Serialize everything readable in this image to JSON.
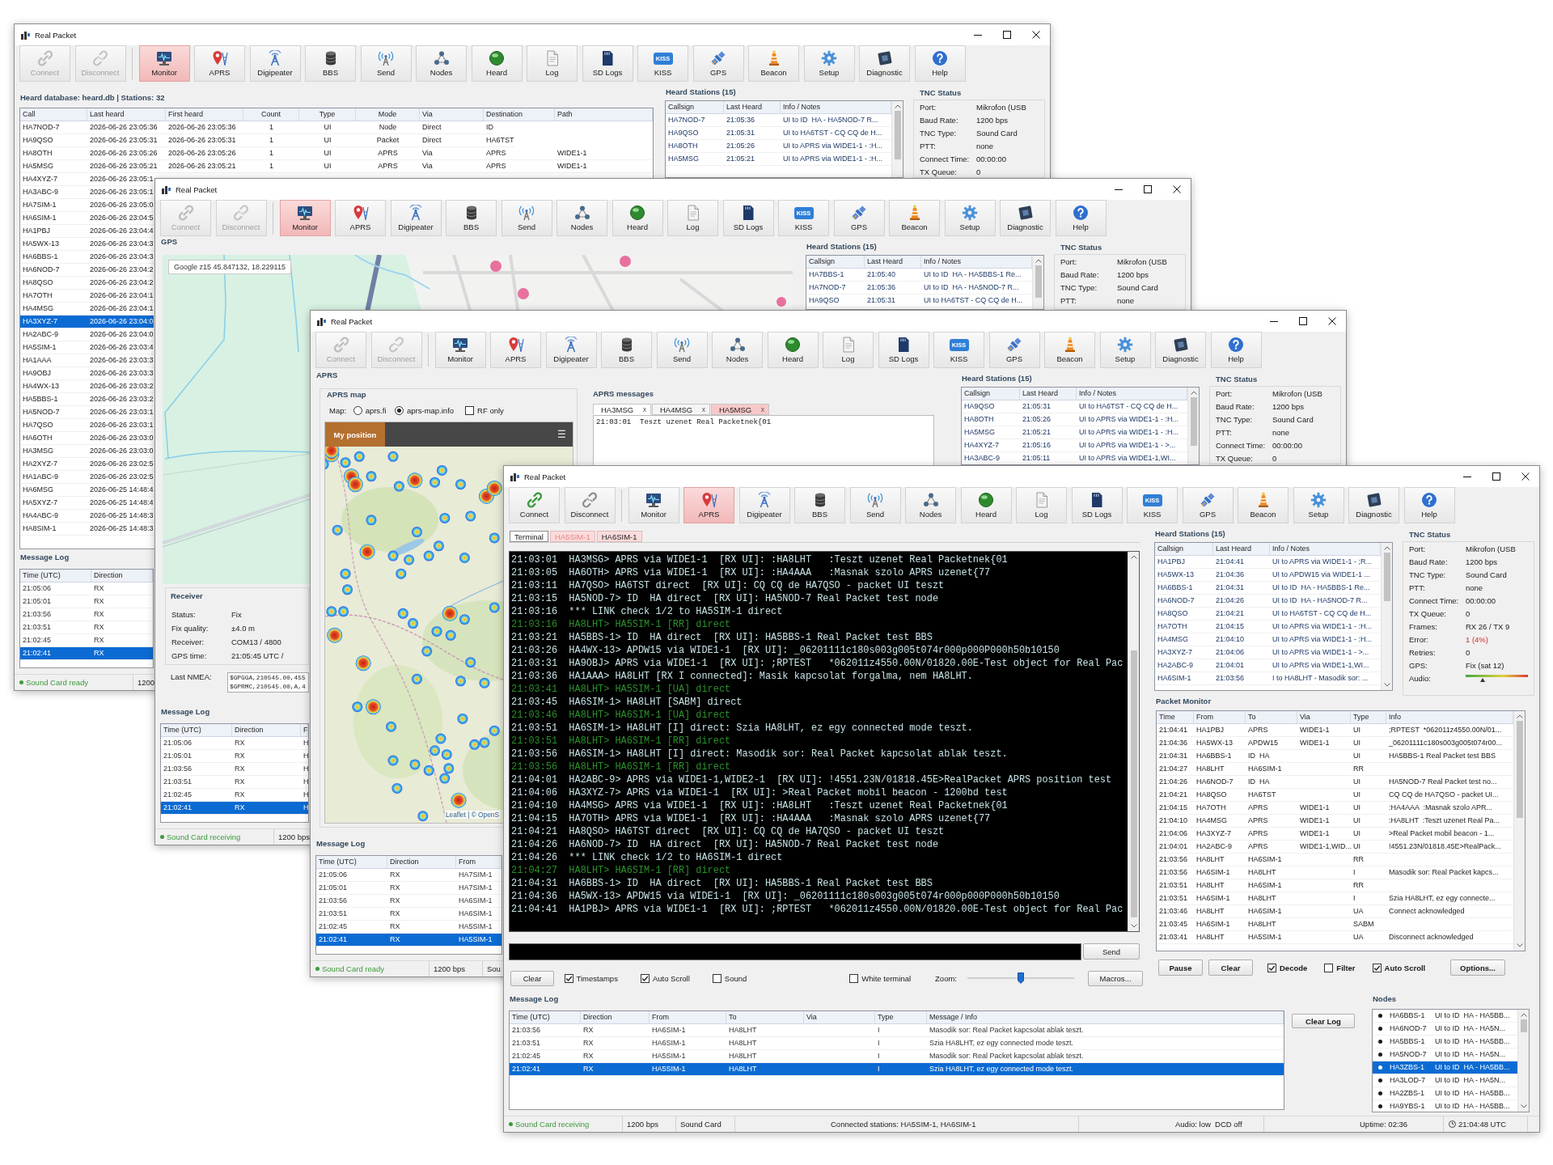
{
  "windows": [
    {
      "kind": "heard_db",
      "title": "Real Packet",
      "toolbar": [
        {
          "label": "Connect",
          "selected": false,
          "disabled": true
        },
        {
          "label": "Disconnect",
          "selected": false,
          "disabled": true
        },
        {
          "label": "Monitor",
          "selected": true,
          "disabled": false
        },
        {
          "label": "APRS",
          "selected": false,
          "disabled": false
        },
        {
          "label": "Digipeater",
          "selected": false,
          "disabled": false
        },
        {
          "label": "BBS",
          "selected": false,
          "disabled": false
        },
        {
          "label": "Send",
          "selected": false,
          "disabled": false
        },
        {
          "label": "Nodes",
          "selected": false,
          "disabled": false
        },
        {
          "label": "Heard",
          "selected": false,
          "disabled": false
        },
        {
          "label": "Log",
          "selected": false,
          "disabled": false
        },
        {
          "label": "SD Logs",
          "selected": false,
          "disabled": false
        },
        {
          "label": "KISS",
          "badge": "KISS",
          "selected": false,
          "disabled": false
        },
        {
          "label": "GPS",
          "selected": false,
          "disabled": false
        },
        {
          "label": "Beacon",
          "selected": false,
          "disabled": false
        },
        {
          "label": "Setup",
          "selected": false,
          "disabled": false
        },
        {
          "label": "Diagnostic",
          "selected": false,
          "disabled": false
        },
        {
          "label": "Help",
          "selected": false,
          "disabled": false
        }
      ],
      "heard_db": {
        "title": "Heard database: heard.db | Stations: 32",
        "columns": [
          "Call",
          "Last heard",
          "First heard",
          "Count",
          "Type",
          "Mode",
          "Via",
          "Destination",
          "Path"
        ],
        "rows": [
          {
            "call": "HA7NOD-7",
            "last_heard": "2026-06-26 23:05:36",
            "first_heard": "2026-06-26 23:05:36",
            "count": "1",
            "type": "UI",
            "mode": "Node",
            "via": "Direct",
            "destination": "ID",
            "selected": false
          },
          {
            "call": "HA9QSO",
            "last_heard": "2026-06-26 23:05:31",
            "first_heard": "2026-06-26 23:05:31",
            "count": "1",
            "type": "UI",
            "mode": "Packet",
            "via": "Direct",
            "destination": "HA6TST",
            "selected": false
          },
          {
            "call": "HA8OTH",
            "last_heard": "2026-06-26 23:05:26",
            "first_heard": "2026-06-26 23:05:26",
            "count": "1",
            "type": "UI",
            "mode": "APRS",
            "via": "Via",
            "destination": "APRS",
            "path": "WIDE1-1",
            "selected": false
          },
          {
            "call": "HA5MSG",
            "last_heard": "2026-06-26 23:05:21",
            "first_heard": "2026-06-26 23:05:21",
            "count": "1",
            "type": "UI",
            "mode": "APRS",
            "via": "Via",
            "destination": "APRS",
            "path": "WIDE1-1",
            "selected": false
          },
          {
            "call": "HA4XYZ-7",
            "last_heard": "2026-06-26 23:05:1",
            "selected": false
          },
          {
            "call": "HA3ABC-9",
            "last_heard": "2026-06-26 23:05:1",
            "selected": false
          },
          {
            "call": "HA7SIM-1",
            "last_heard": "2026-06-26 23:05:0",
            "selected": false
          },
          {
            "call": "HA6SIM-1",
            "last_heard": "2026-06-26 23:04:5",
            "selected": false
          },
          {
            "call": "HA1PBJ",
            "last_heard": "2026-06-26 23:04:4",
            "selected": false
          },
          {
            "call": "HA5WX-13",
            "last_heard": "2026-06-26 23:04:3",
            "selected": false
          },
          {
            "call": "HA6BBS-1",
            "last_heard": "2026-06-26 23:04:3",
            "selected": false
          },
          {
            "call": "HA6NOD-7",
            "last_heard": "2026-06-26 23:04:2",
            "selected": false
          },
          {
            "call": "HA8QSO",
            "last_heard": "2026-06-26 23:04:2",
            "selected": false
          },
          {
            "call": "HA7OTH",
            "last_heard": "2026-06-26 23:04:1",
            "selected": false
          },
          {
            "call": "HA4MSG",
            "last_heard": "2026-06-26 23:04:1",
            "selected": false
          },
          {
            "call": "HA3XYZ-7",
            "last_heard": "2026-06-26 23:04:0",
            "selected": true
          },
          {
            "call": "HA2ABC-9",
            "last_heard": "2026-06-26 23:04:0",
            "selected": false
          },
          {
            "call": "HA5SIM-1",
            "last_heard": "2026-06-26 23:03:4",
            "selected": false
          },
          {
            "call": "HA1AAA",
            "last_heard": "2026-06-26 23:03:3",
            "selected": false
          },
          {
            "call": "HA9OBJ",
            "last_heard": "2026-06-26 23:03:3",
            "selected": false
          },
          {
            "call": "HA4WX-13",
            "last_heard": "2026-06-26 23:03:2",
            "selected": false
          },
          {
            "call": "HA5BBS-1",
            "last_heard": "2026-06-26 23:03:2",
            "selected": false
          },
          {
            "call": "HA5NOD-7",
            "last_heard": "2026-06-26 23:03:1",
            "selected": false
          },
          {
            "call": "HA7QSO",
            "last_heard": "2026-06-26 23:03:1",
            "selected": false
          },
          {
            "call": "HA6OTH",
            "last_heard": "2026-06-26 23:03:0",
            "selected": false
          },
          {
            "call": "HA3MSG",
            "last_heard": "2026-06-26 23:03:0",
            "selected": false
          },
          {
            "call": "HA2XYZ-7",
            "last_heard": "2026-06-26 23:02:5",
            "selected": false
          },
          {
            "call": "HA1ABC-9",
            "last_heard": "2026-06-26 23:02:5",
            "selected": false
          },
          {
            "call": "HA6MSG",
            "last_heard": "2026-06-25 14:48:4",
            "selected": false
          },
          {
            "call": "HA5XYZ-7",
            "last_heard": "2026-06-25 14:48:4",
            "selected": false
          },
          {
            "call": "HA4ABC-9",
            "last_heard": "2026-06-25 14:48:3",
            "selected": false
          },
          {
            "call": "HA8SIM-1",
            "last_heard": "2026-06-25 14:48:3",
            "selected": false
          }
        ]
      },
      "heard_stations": {
        "title": "Heard Stations (15)",
        "columns": [
          "Callsign",
          "Last Heard",
          "Info / Notes"
        ],
        "rows": [
          {
            "callsign": "HA7NOD-7",
            "last_heard": "21:05:36",
            "info": "UI to ID  HA - HA5NOD-7 R...",
            "selected": false
          },
          {
            "callsign": "HA9QSO",
            "last_heard": "21:05:31",
            "info": "UI to HA6TST - CQ CQ de H...",
            "selected": false
          },
          {
            "callsign": "HA8OTH",
            "last_heard": "21:05:26",
            "info": "UI to APRS via WIDE1-1 - :H...",
            "selected": false
          },
          {
            "callsign": "HA5MSG",
            "last_heard": "21:05:21",
            "info": "UI to APRS via WIDE1-1 - :H...",
            "selected": false
          }
        ]
      },
      "tnc_status": {
        "title": "TNC Status",
        "rows": [
          {
            "kind": "text",
            "label": "Port:",
            "value": "Mikrofon (USB"
          },
          {
            "kind": "text",
            "label": "Baud Rate:",
            "value": "1200 bps"
          },
          {
            "kind": "text",
            "label": "TNC Type:",
            "value": "Sound Card"
          },
          {
            "kind": "text",
            "label": "PTT:",
            "value": "none"
          },
          {
            "kind": "text",
            "label": "Connect Time:",
            "value": "00:00:00"
          },
          {
            "kind": "text",
            "label": "TX Queue:",
            "value": "0"
          }
        ]
      },
      "message_log": {
        "title": "Message Log",
        "columns": [
          "Time (UTC)",
          "Direction"
        ],
        "rows": [
          {
            "time": "21:05:06",
            "direction": "RX",
            "selected": false
          },
          {
            "time": "21:05:01",
            "direction": "RX",
            "selected": false
          },
          {
            "time": "21:03:56",
            "direction": "RX",
            "selected": false
          },
          {
            "time": "21:03:51",
            "direction": "RX",
            "selected": false
          },
          {
            "time": "21:02:45",
            "direction": "RX",
            "selected": false
          },
          {
            "time": "21:02:41",
            "direction": "RX",
            "selected": true
          }
        ]
      },
      "status_bar": [
        "Sound Card ready",
        "1200"
      ]
    },
    {
      "kind": "gps",
      "title": "Real Packet",
      "toolbar": [
        {
          "label": "Connect",
          "selected": false,
          "disabled": true
        },
        {
          "label": "Disconnect",
          "selected": false,
          "disabled": true
        },
        {
          "label": "Monitor",
          "selected": true,
          "disabled": false
        },
        {
          "label": "APRS",
          "selected": false,
          "disabled": false
        },
        {
          "label": "Digipeater",
          "selected": false,
          "disabled": false
        },
        {
          "label": "BBS",
          "selected": false,
          "disabled": false
        },
        {
          "label": "Send",
          "selected": false,
          "disabled": false
        },
        {
          "label": "Nodes",
          "selected": false,
          "disabled": false
        },
        {
          "label": "Heard",
          "selected": false,
          "disabled": false
        },
        {
          "label": "Log",
          "selected": false,
          "disabled": false
        },
        {
          "label": "SD Logs",
          "selected": false,
          "disabled": false
        },
        {
          "label": "KISS",
          "badge": "KISS",
          "selected": false,
          "disabled": false
        },
        {
          "label": "GPS",
          "selected": false,
          "disabled": false
        },
        {
          "label": "Beacon",
          "selected": false,
          "disabled": false
        },
        {
          "label": "Setup",
          "selected": false,
          "disabled": false
        },
        {
          "label": "Diagnostic",
          "selected": false,
          "disabled": false
        },
        {
          "label": "Help",
          "selected": false,
          "disabled": false
        }
      ],
      "gps": {
        "title": "GPS",
        "map_label": "Google z15 45.847132, 18.229115",
        "receiver": {
          "title": "Receiver",
          "rows": [
            {
              "label": "Status:",
              "value": "Fix"
            },
            {
              "label": "Fix quality:",
              "value": "±4.0 m"
            },
            {
              "label": "Receiver:",
              "value": "COM13 / 4800"
            },
            {
              "label": "GPS time:",
              "value": "21:05:45 UTC /"
            }
          ]
        },
        "nmea": {
          "label": "Last NMEA:",
          "lines": [
            "$GPGGA,210545.00,455",
            "$GPRMC,210545.00,A,4"
          ]
        }
      },
      "heard_stations": {
        "title": "Heard Stations (15)",
        "columns": [
          "Callsign",
          "Last Heard",
          "Info / Notes"
        ],
        "rows": [
          {
            "callsign": "HA7BBS-1",
            "last_heard": "21:05:40",
            "info": "UI to ID  HA - HA5BBS-1 Re...",
            "selected": false
          },
          {
            "callsign": "HA7NOD-7",
            "last_heard": "21:05:36",
            "info": "UI to ID  HA - HA5NOD-7 R...",
            "selected": false
          },
          {
            "callsign": "HA9QSO",
            "last_heard": "21:05:31",
            "info": "UI to HA6TST - CQ CQ de H...",
            "selected": false
          }
        ]
      },
      "tnc_status": {
        "title": "TNC Status",
        "rows": [
          {
            "kind": "text",
            "label": "Port:",
            "value": "Mikrofon (USB"
          },
          {
            "kind": "text",
            "label": "Baud Rate:",
            "value": "1200 bps"
          },
          {
            "kind": "text",
            "label": "TNC Type:",
            "value": "Sound Card"
          },
          {
            "kind": "text",
            "label": "PTT:",
            "value": "none"
          }
        ]
      },
      "message_log": {
        "title": "Message Log",
        "columns": [
          "Time (UTC)",
          "Direction",
          "F"
        ],
        "rows": [
          {
            "time": "21:05:06",
            "direction": "RX",
            "from": "H",
            "selected": false
          },
          {
            "time": "21:05:01",
            "direction": "RX",
            "from": "H",
            "selected": false
          },
          {
            "time": "21:03:56",
            "direction": "RX",
            "from": "H",
            "selected": false
          },
          {
            "time": "21:03:51",
            "direction": "RX",
            "from": "H",
            "selected": false
          },
          {
            "time": "21:02:45",
            "direction": "RX",
            "from": "H",
            "selected": false
          },
          {
            "time": "21:02:41",
            "direction": "RX",
            "from": "H",
            "selected": true
          }
        ]
      },
      "status_bar": [
        "Sound Card receiving",
        "1200 bps"
      ]
    },
    {
      "kind": "aprs",
      "title": "Real Packet",
      "toolbar": [
        {
          "label": "Connect",
          "selected": false,
          "disabled": true
        },
        {
          "label": "Disconnect",
          "selected": false,
          "disabled": true
        },
        {
          "label": "Monitor",
          "selected": false,
          "disabled": false
        },
        {
          "label": "APRS",
          "selected": false,
          "disabled": false
        },
        {
          "label": "Digipeater",
          "selected": false,
          "disabled": false
        },
        {
          "label": "BBS",
          "selected": false,
          "disabled": false
        },
        {
          "label": "Send",
          "selected": false,
          "disabled": false
        },
        {
          "label": "Nodes",
          "selected": false,
          "disabled": false
        },
        {
          "label": "Heard",
          "selected": false,
          "disabled": false
        },
        {
          "label": "Log",
          "selected": false,
          "disabled": false
        },
        {
          "label": "SD Logs",
          "selected": false,
          "disabled": false
        },
        {
          "label": "KISS",
          "badge": "KISS",
          "selected": false,
          "disabled": false
        },
        {
          "label": "GPS",
          "selected": false,
          "disabled": false
        },
        {
          "label": "Beacon",
          "selected": false,
          "disabled": false
        },
        {
          "label": "Setup",
          "selected": false,
          "disabled": false
        },
        {
          "label": "Diagnostic",
          "selected": false,
          "disabled": false
        },
        {
          "label": "Help",
          "selected": false,
          "disabled": false
        }
      ],
      "aprs": {
        "title": "APRS",
        "map_group": {
          "title": "APRS map",
          "map_label": "Map:",
          "options": [
            {
              "label": "aprs.fi",
              "selected": false
            },
            {
              "label": "aprs-map.info",
              "selected": true
            }
          ],
          "rf_only": {
            "label": "RF only",
            "checked": false
          },
          "my_position": "My position",
          "menu": "☰",
          "attribution": "Leaflet | © OpenS"
        },
        "messages": {
          "title": "APRS messages",
          "tabs": [
            {
              "label": "HA3MSG",
              "close": "x",
              "selected": true,
              "unread": false
            },
            {
              "label": "HA4MSG",
              "close": "x",
              "selected": false,
              "unread": false
            },
            {
              "label": "HA5MSG",
              "close": "x",
              "selected": false,
              "unread": true
            }
          ],
          "lines": [
            "21:03:01  Teszt uzenet Real Packetnek{01"
          ]
        }
      },
      "heard_stations": {
        "title": "Heard Stations (15)",
        "columns": [
          "Callsign",
          "Last Heard",
          "Info / Notes"
        ],
        "rows": [
          {
            "callsign": "HA9QSO",
            "last_heard": "21:05:31",
            "info": "UI to HA6TST - CQ CQ de H...",
            "selected": false
          },
          {
            "callsign": "HA8OTH",
            "last_heard": "21:05:26",
            "info": "UI to APRS via WIDE1-1 - :H...",
            "selected": false
          },
          {
            "callsign": "HA5MSG",
            "last_heard": "21:05:21",
            "info": "UI to APRS via WIDE1-1 - :H...",
            "selected": false
          },
          {
            "callsign": "HA4XYZ-7",
            "last_heard": "21:05:16",
            "info": "UI to APRS via WIDE1-1 - >...",
            "selected": false
          },
          {
            "callsign": "HA3ABC-9",
            "last_heard": "21:05:11",
            "info": "UI to APRS via WIDE1-1,WI...",
            "selected": false
          }
        ]
      },
      "tnc_status": {
        "title": "TNC Status",
        "rows": [
          {
            "kind": "text",
            "label": "Port:",
            "value": "Mikrofon (USB"
          },
          {
            "kind": "text",
            "label": "Baud Rate:",
            "value": "1200 bps"
          },
          {
            "kind": "text",
            "label": "TNC Type:",
            "value": "Sound Card"
          },
          {
            "kind": "text",
            "label": "PTT:",
            "value": "none"
          },
          {
            "kind": "text",
            "label": "Connect Time:",
            "value": "00:00:00"
          },
          {
            "kind": "text",
            "label": "TX Queue:",
            "value": "0"
          }
        ]
      },
      "message_log": {
        "title": "Message Log",
        "columns": [
          "Time (UTC)",
          "Direction",
          "From"
        ],
        "rows": [
          {
            "time": "21:05:06",
            "direction": "RX",
            "from": "HA7SIM-1",
            "selected": false
          },
          {
            "time": "21:05:01",
            "direction": "RX",
            "from": "HA7SIM-1",
            "selected": false
          },
          {
            "time": "21:03:56",
            "direction": "RX",
            "from": "HA6SIM-1",
            "selected": false
          },
          {
            "time": "21:03:51",
            "direction": "RX",
            "from": "HA6SIM-1",
            "selected": false
          },
          {
            "time": "21:02:45",
            "direction": "RX",
            "from": "HA5SIM-1",
            "selected": false
          },
          {
            "time": "21:02:41",
            "direction": "RX",
            "from": "HA5SIM-1",
            "selected": true
          }
        ]
      },
      "status_bar": [
        "Sound Card ready",
        "1200 bps",
        "Sou"
      ]
    },
    {
      "kind": "terminal",
      "title": "Real Packet",
      "toolbar": [
        {
          "label": "Connect",
          "selected": false,
          "disabled": false
        },
        {
          "label": "Disconnect",
          "selected": false,
          "disabled": false
        },
        {
          "label": "Monitor",
          "selected": false,
          "disabled": false
        },
        {
          "label": "APRS",
          "selected": true,
          "disabled": false
        },
        {
          "label": "Digipeater",
          "selected": false,
          "disabled": false
        },
        {
          "label": "BBS",
          "selected": false,
          "disabled": false
        },
        {
          "label": "Send",
          "selected": false,
          "disabled": false
        },
        {
          "label": "Nodes",
          "selected": false,
          "disabled": false
        },
        {
          "label": "Heard",
          "selected": false,
          "disabled": false
        },
        {
          "label": "Log",
          "selected": false,
          "disabled": false
        },
        {
          "label": "SD Logs",
          "selected": false,
          "disabled": false
        },
        {
          "label": "KISS",
          "badge": "KISS",
          "selected": false,
          "disabled": false
        },
        {
          "label": "GPS",
          "selected": false,
          "disabled": false
        },
        {
          "label": "Beacon",
          "selected": false,
          "disabled": false
        },
        {
          "label": "Setup",
          "selected": false,
          "disabled": false
        },
        {
          "label": "Diagnostic",
          "selected": false,
          "disabled": false
        },
        {
          "label": "Help",
          "selected": false,
          "disabled": false
        }
      ],
      "terminal": {
        "tabs": [
          {
            "label": "Terminal",
            "selected": true
          },
          {
            "label": "HA5SIM-1",
            "selected": false,
            "connected": false
          },
          {
            "label": "HA6SIM-1",
            "selected": false,
            "connected": true
          }
        ],
        "lines": [
          {
            "kind": "rx",
            "text": "21:03:01  HA3MSG> APRS via WIDE1-1  [RX UI]: :HA8LHT   :Teszt uzenet Real Packetnek{01"
          },
          {
            "kind": "rx",
            "text": "21:03:05  HA6OTH> APRS via WIDE1-1  [RX UI]: :HA4AAA   :Masnak szolo APRS uzenet{77"
          },
          {
            "kind": "rx",
            "text": "21:03:11  HA7QSO> HA6TST direct  [RX UI]: CQ CQ de HA7QSO - packet UI teszt"
          },
          {
            "kind": "rx",
            "text": "21:03:15  HA5NOD-7> ID  HA direct  [RX UI]: HA5NOD-7 Real Packet test node"
          },
          {
            "kind": "rx",
            "text": "21:03:16  *** LINK check 1/2 to HA5SIM-1 direct"
          },
          {
            "kind": "tx",
            "text": "21:03:16  HA8LHT> HA5SIM-1 [RR] direct"
          },
          {
            "kind": "rx",
            "text": "21:03:21  HA5BBS-1> ID  HA direct  [RX UI]: HA5BBS-1 Real Packet test BBS"
          },
          {
            "kind": "rx",
            "text": "21:03:26  HA4WX-13> APDW15 via WIDE1-1  [RX UI]: _06201111c180s003g005t074r000p000P000h50b10150"
          },
          {
            "kind": "rx",
            "text": "21:03:31  HA9OBJ> APRS via WIDE1-1  [RX UI]: ;RPTEST   *062011z4550.00N/01820.00E-Test object for Real Pac"
          },
          {
            "kind": "rx",
            "text": "21:03:36  HA1AAA> HA8LHT [RX I connected]: Masik kapcsolat forgalma, nem HA8LHT."
          },
          {
            "kind": "tx",
            "text": "21:03:41  HA8LHT> HA5SIM-1 [UA] direct"
          },
          {
            "kind": "rx",
            "text": "21:03:45  HA6SIM-1> HA8LHT [SABM] direct"
          },
          {
            "kind": "tx",
            "text": "21:03:46  HA8LHT> HA6SIM-1 [UA] direct"
          },
          {
            "kind": "rx",
            "text": "21:03:51  HA6SIM-1> HA8LHT [I] direct: Szia HA8LHT, ez egy connected mode teszt."
          },
          {
            "kind": "tx",
            "text": "21:03:51  HA8LHT> HA6SIM-1 [RR] direct"
          },
          {
            "kind": "rx",
            "text": "21:03:56  HA6SIM-1> HA8LHT [I] direct: Masodik sor: Real Packet kapcsolat ablak teszt."
          },
          {
            "kind": "tx",
            "text": "21:03:56  HA8LHT> HA6SIM-1 [RR] direct"
          },
          {
            "kind": "rx",
            "text": "21:04:01  HA2ABC-9> APRS via WIDE1-1,WIDE2-1  [RX UI]: !4551.23N/01818.45E>RealPacket APRS position test"
          },
          {
            "kind": "rx",
            "text": "21:04:06  HA3XYZ-7> APRS via WIDE1-1  [RX UI]: >Real Packet mobil beacon - 1200bd test"
          },
          {
            "kind": "rx",
            "text": "21:04:10  HA4MSG> APRS via WIDE1-1  [RX UI]: :HA8LHT   :Teszt uzenet Real Packetnek{01"
          },
          {
            "kind": "rx",
            "text": "21:04:15  HA7OTH> APRS via WIDE1-1  [RX UI]: :HA4AAA   :Masnak szolo APRS uzenet{77"
          },
          {
            "kind": "rx",
            "text": "21:04:21  HA8QSO> HA6TST direct  [RX UI]: CQ CQ de HA7QSO - packet UI teszt"
          },
          {
            "kind": "rx",
            "text": "21:04:26  HA6NOD-7> ID  HA direct  [RX UI]: HA5NOD-7 Real Packet test node"
          },
          {
            "kind": "rx",
            "text": "21:04:26  *** LINK check 1/2 to HA6SIM-1 direct"
          },
          {
            "kind": "tx",
            "text": "21:04:27  HA8LHT> HA6SIM-1 [RR] direct"
          },
          {
            "kind": "rx",
            "text": "21:04:31  HA6BBS-1> ID  HA direct  [RX UI]: HA5BBS-1 Real Packet test BBS"
          },
          {
            "kind": "rx",
            "text": "21:04:36  HA5WX-13> APDW15 via WIDE1-1  [RX UI]: _06201111c180s003g005t074r000p000P000h50b10150"
          },
          {
            "kind": "rx",
            "text": "21:04:41  HA1PBJ> APRS via WIDE1-1  [RX UI]: ;RPTEST   *062011z4550.00N/01820.00E-Test object for Real Pac"
          }
        ],
        "send": "Send",
        "clear": "Clear",
        "checkboxes": [
          {
            "label": "Timestamps",
            "checked": true
          },
          {
            "label": "Auto Scroll",
            "checked": true
          },
          {
            "label": "Sound",
            "checked": false
          }
        ],
        "view_checkboxes": [
          {
            "label": "White terminal",
            "checked": false
          }
        ],
        "zoom_label": "Zoom:",
        "zoom": {
          "level": 0.5
        },
        "macros": "Macros..."
      },
      "heard_stations": {
        "title": "Heard Stations (15)",
        "columns": [
          "Callsign",
          "Last Heard",
          "Info / Notes"
        ],
        "rows": [
          {
            "callsign": "HA1PBJ",
            "last_heard": "21:04:41",
            "info": "UI to APRS via WIDE1-1 - ;R...",
            "selected": false
          },
          {
            "callsign": "HA5WX-13",
            "last_heard": "21:04:36",
            "info": "UI to APDW15 via WIDE1-1 ...",
            "selected": false
          },
          {
            "callsign": "HA6BBS-1",
            "last_heard": "21:04:31",
            "info": "UI to ID  HA - HA5BBS-1 Re...",
            "selected": false
          },
          {
            "callsign": "HA6NOD-7",
            "last_heard": "21:04:26",
            "info": "UI to ID  HA - HA5NOD-7 R...",
            "selected": false
          },
          {
            "callsign": "HA8QSO",
            "last_heard": "21:04:21",
            "info": "UI to HA6TST - CQ CQ de H...",
            "selected": false
          },
          {
            "callsign": "HA7OTH",
            "last_heard": "21:04:15",
            "info": "UI to APRS via WIDE1-1 - :H...",
            "selected": false
          },
          {
            "callsign": "HA4MSG",
            "last_heard": "21:04:10",
            "info": "UI to APRS via WIDE1-1 - :H...",
            "selected": false
          },
          {
            "callsign": "HA3XYZ-7",
            "last_heard": "21:04:06",
            "info": "UI to APRS via WIDE1-1 - >...",
            "selected": false
          },
          {
            "callsign": "HA2ABC-9",
            "last_heard": "21:04:01",
            "info": "UI to APRS via WIDE1-1,WI...",
            "selected": false
          },
          {
            "callsign": "HA6SIM-1",
            "last_heard": "21:03:56",
            "info": "I to HA8LHT - Masodik sor: ...",
            "selected": false
          }
        ]
      },
      "tnc_status": {
        "title": "TNC Status",
        "rows": [
          {
            "kind": "text",
            "label": "Port:",
            "value": "Mikrofon (USB"
          },
          {
            "kind": "text",
            "label": "Baud Rate:",
            "value": "1200 bps"
          },
          {
            "kind": "text",
            "label": "TNC Type:",
            "value": "Sound Card"
          },
          {
            "kind": "text",
            "label": "PTT:",
            "value": "none"
          },
          {
            "kind": "text",
            "label": "Connect Time:",
            "value": "00:00:00"
          },
          {
            "kind": "text",
            "label": "TX Queue:",
            "value": "0"
          },
          {
            "kind": "text",
            "label": "Frames:",
            "value": "RX 26 / TX 9"
          },
          {
            "kind": "error",
            "label": "Error:",
            "value": "1 (4%)"
          },
          {
            "kind": "text",
            "label": "Retries:",
            "value": "0"
          },
          {
            "kind": "text",
            "label": "GPS:",
            "value": "Fix (sat 12)"
          },
          {
            "kind": "meter",
            "label": "Audio:",
            "level": 0.25
          }
        ]
      },
      "packet_monitor": {
        "title": "Packet Monitor",
        "columns": [
          "Time",
          "From",
          "To",
          "Via",
          "Type",
          "Info"
        ],
        "rows": [
          {
            "time": "21:04:41",
            "from": "HA1PBJ",
            "to": "APRS",
            "via": "WIDE1-1",
            "type": "UI",
            "info": ";RPTEST  *062011z4550.00N/01...",
            "selected": false
          },
          {
            "time": "21:04:36",
            "from": "HA5WX-13",
            "to": "APDW15",
            "via": "WIDE1-1",
            "type": "UI",
            "info": "_06201111c180s003g005t074r00...",
            "selected": false
          },
          {
            "time": "21:04:31",
            "from": "HA6BBS-1",
            "to": "ID  HA",
            "type": "UI",
            "info": "HA5BBS-1 Real Packet test BBS",
            "selected": false
          },
          {
            "time": "21:04:27",
            "from": "HA8LHT",
            "to": "HA6SIM-1",
            "type": "RR",
            "selected": false
          },
          {
            "time": "21:04:26",
            "from": "HA6NOD-7",
            "to": "ID  HA",
            "type": "UI",
            "info": "HA5NOD-7 Real Packet test no...",
            "selected": false
          },
          {
            "time": "21:04:21",
            "from": "HA8QSO",
            "to": "HA6TST",
            "type": "UI",
            "info": "CQ CQ de HA7QSO - packet UI...",
            "selected": false
          },
          {
            "time": "21:04:15",
            "from": "HA7OTH",
            "to": "APRS",
            "via": "WIDE1-1",
            "type": "UI",
            "info": ":HA4AAA  :Masnak szolo APR...",
            "selected": false
          },
          {
            "time": "21:04:10",
            "from": "HA4MSG",
            "to": "APRS",
            "via": "WIDE1-1",
            "type": "UI",
            "info": ":HA8LHT  :Teszt uzenet Real Pa...",
            "selected": false
          },
          {
            "time": "21:04:06",
            "from": "HA3XYZ-7",
            "to": "APRS",
            "via": "WIDE1-1",
            "type": "UI",
            "info": ">Real Packet mobil beacon - 1...",
            "selected": false
          },
          {
            "time": "21:04:01",
            "from": "HA2ABC-9",
            "to": "APRS",
            "via": "WIDE1-1,WID...",
            "type": "UI",
            "info": "!4551.23N/01818.45E>RealPack...",
            "selected": false
          },
          {
            "time": "21:03:56",
            "from": "HA8LHT",
            "to": "HA6SIM-1",
            "type": "RR",
            "selected": false
          },
          {
            "time": "21:03:56",
            "from": "HA6SIM-1",
            "to": "HA8LHT",
            "type": "I",
            "info": "Masodik sor: Real Packet kapcs...",
            "selected": false
          },
          {
            "time": "21:03:51",
            "from": "HA8LHT",
            "to": "HA6SIM-1",
            "type": "RR",
            "selected": false
          },
          {
            "time": "21:03:51",
            "from": "HA6SIM-1",
            "to": "HA8LHT",
            "type": "I",
            "info": "Szia HA8LHT, ez egy connecte...",
            "selected": false
          },
          {
            "time": "21:03:46",
            "from": "HA8LHT",
            "to": "HA6SIM-1",
            "type": "UA",
            "info": "Connect acknowledged",
            "selected": false
          },
          {
            "time": "21:03:45",
            "from": "HA6SIM-1",
            "to": "HA8LHT",
            "type": "SABM",
            "selected": false
          },
          {
            "time": "21:03:41",
            "from": "HA8LHT",
            "to": "HA5SIM-1",
            "type": "UA",
            "info": "Disconnect acknowledged",
            "selected": false
          }
        ],
        "buttons": [
          "Pause",
          "Clear"
        ],
        "checkboxes": [
          {
            "label": "Decode",
            "checked": true
          },
          {
            "label": "Filter",
            "checked": false
          },
          {
            "label": "Auto Scroll",
            "checked": true
          }
        ],
        "options": "Options..."
      },
      "message_log": {
        "title": "Message Log",
        "columns": [
          "Time (UTC)",
          "Direction",
          "From",
          "To",
          "Via",
          "Type",
          "Message / Info"
        ],
        "rows": [
          {
            "time": "21:03:56",
            "direction": "RX",
            "from": "HA6SIM-1",
            "to": "HA8LHT",
            "type": "I",
            "info": "Masodik sor: Real Packet kapcsolat ablak teszt.",
            "selected": false
          },
          {
            "time": "21:03:51",
            "direction": "RX",
            "from": "HA6SIM-1",
            "to": "HA8LHT",
            "type": "I",
            "info": "Szia HA8LHT, ez egy connected mode teszt.",
            "selected": false
          },
          {
            "time": "21:02:45",
            "direction": "RX",
            "from": "HA5SIM-1",
            "to": "HA8LHT",
            "type": "I",
            "info": "Masodik sor: Real Packet kapcsolat ablak teszt.",
            "selected": false
          },
          {
            "time": "21:02:41",
            "direction": "RX",
            "from": "HA5SIM-1",
            "to": "HA8LHT",
            "type": "I",
            "info": "Szia HA8LHT, ez egy connected mode teszt.",
            "selected": true
          }
        ],
        "clear_button": "Clear Log"
      },
      "nodes": {
        "title": "Nodes",
        "rows": [
          {
            "call": "HA6BBS-1",
            "info": "UI to ID  HA - HA5BB...",
            "selected": false
          },
          {
            "call": "HA6NOD-7",
            "info": "UI to ID  HA - HA5N...",
            "selected": false
          },
          {
            "call": "HA5BBS-1",
            "info": "UI to ID  HA - HA5BB...",
            "selected": false
          },
          {
            "call": "HA5NOD-7",
            "info": "UI to ID  HA - HA5N...",
            "selected": false
          },
          {
            "call": "HA3ZBS-1",
            "info": "UI to ID  HA - HA5BB...",
            "selected": true
          },
          {
            "call": "HA3LOD-7",
            "info": "UI to ID  HA - HA5N...",
            "selected": false
          },
          {
            "call": "HA2ZBS-1",
            "info": "UI to ID  HA - HA5BB...",
            "selected": false
          },
          {
            "call": "HA9YBS-1",
            "info": "UI to ID  HA - HA5BB...",
            "selected": false
          }
        ]
      },
      "status_bar": [
        "Sound Card receiving",
        "1200 bps",
        "Sound Card",
        "Connected stations: HA5SIM-1, HA6SIM-1",
        "Audio: low  DCD off",
        "Uptime: 02:36",
        "21:04:48 UTC"
      ]
    }
  ]
}
